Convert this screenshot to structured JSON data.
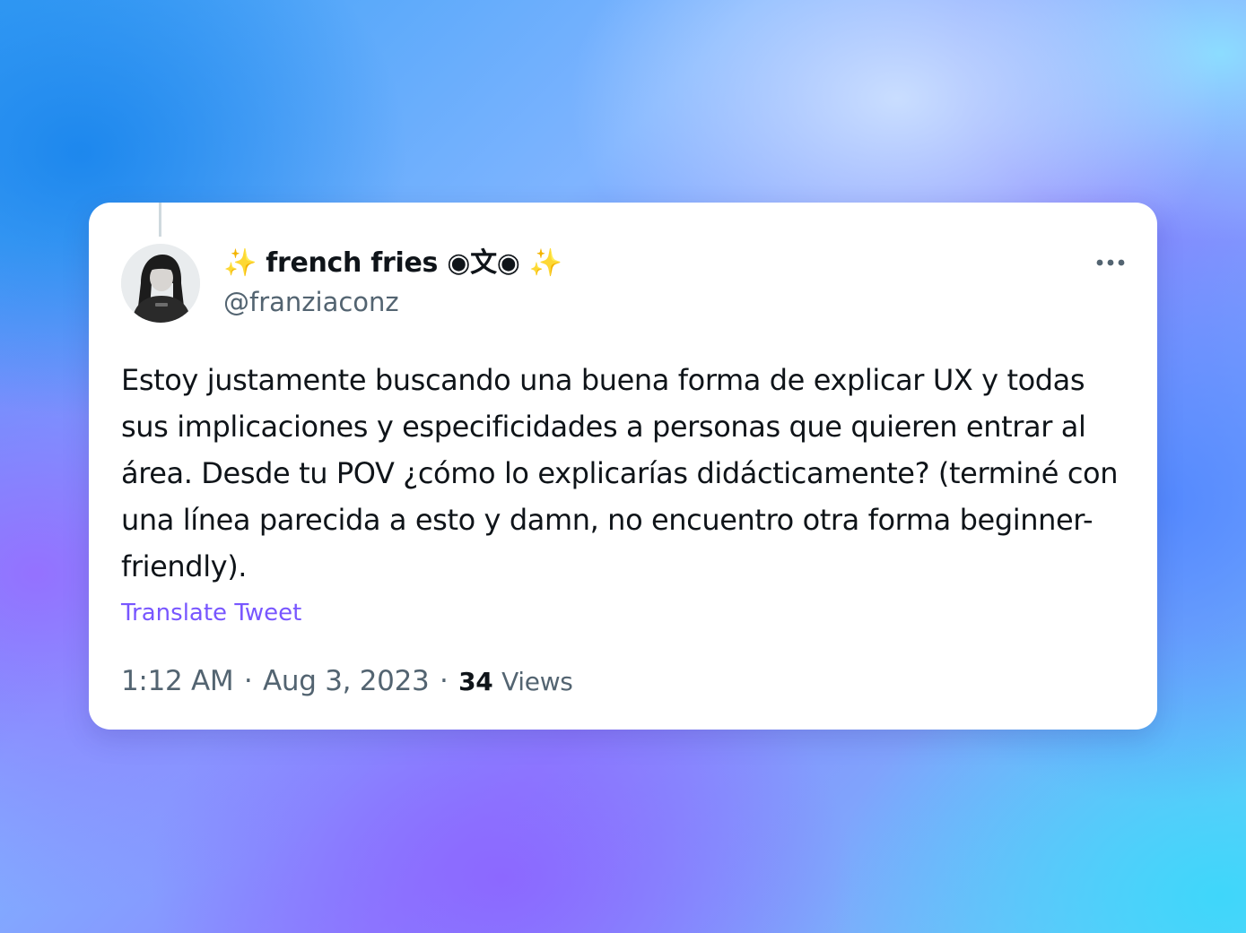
{
  "tweet": {
    "display_name": "✨ french fries ◉⽂◉ ✨",
    "handle": "@franziaconz",
    "text": "Estoy justamente buscando una buena forma de explicar UX y todas sus implicaciones y especificidades a personas que quieren entrar al área. Desde tu POV ¿cómo lo explicarías didácticamente? (terminé con una línea parecida a esto y damn, no encuentro otra forma beginner-friendly).",
    "translate_label": "Translate Tweet",
    "time": "1:12 AM",
    "separator": "·",
    "date": "Aug 3, 2023",
    "views_count": "34",
    "views_label": "Views"
  },
  "icons": {
    "more": "more-dots-icon",
    "avatar": "user-avatar"
  },
  "colors": {
    "text_primary": "#0f1419",
    "text_secondary": "#536471",
    "link": "#7856ff",
    "card_background": "#ffffff"
  }
}
